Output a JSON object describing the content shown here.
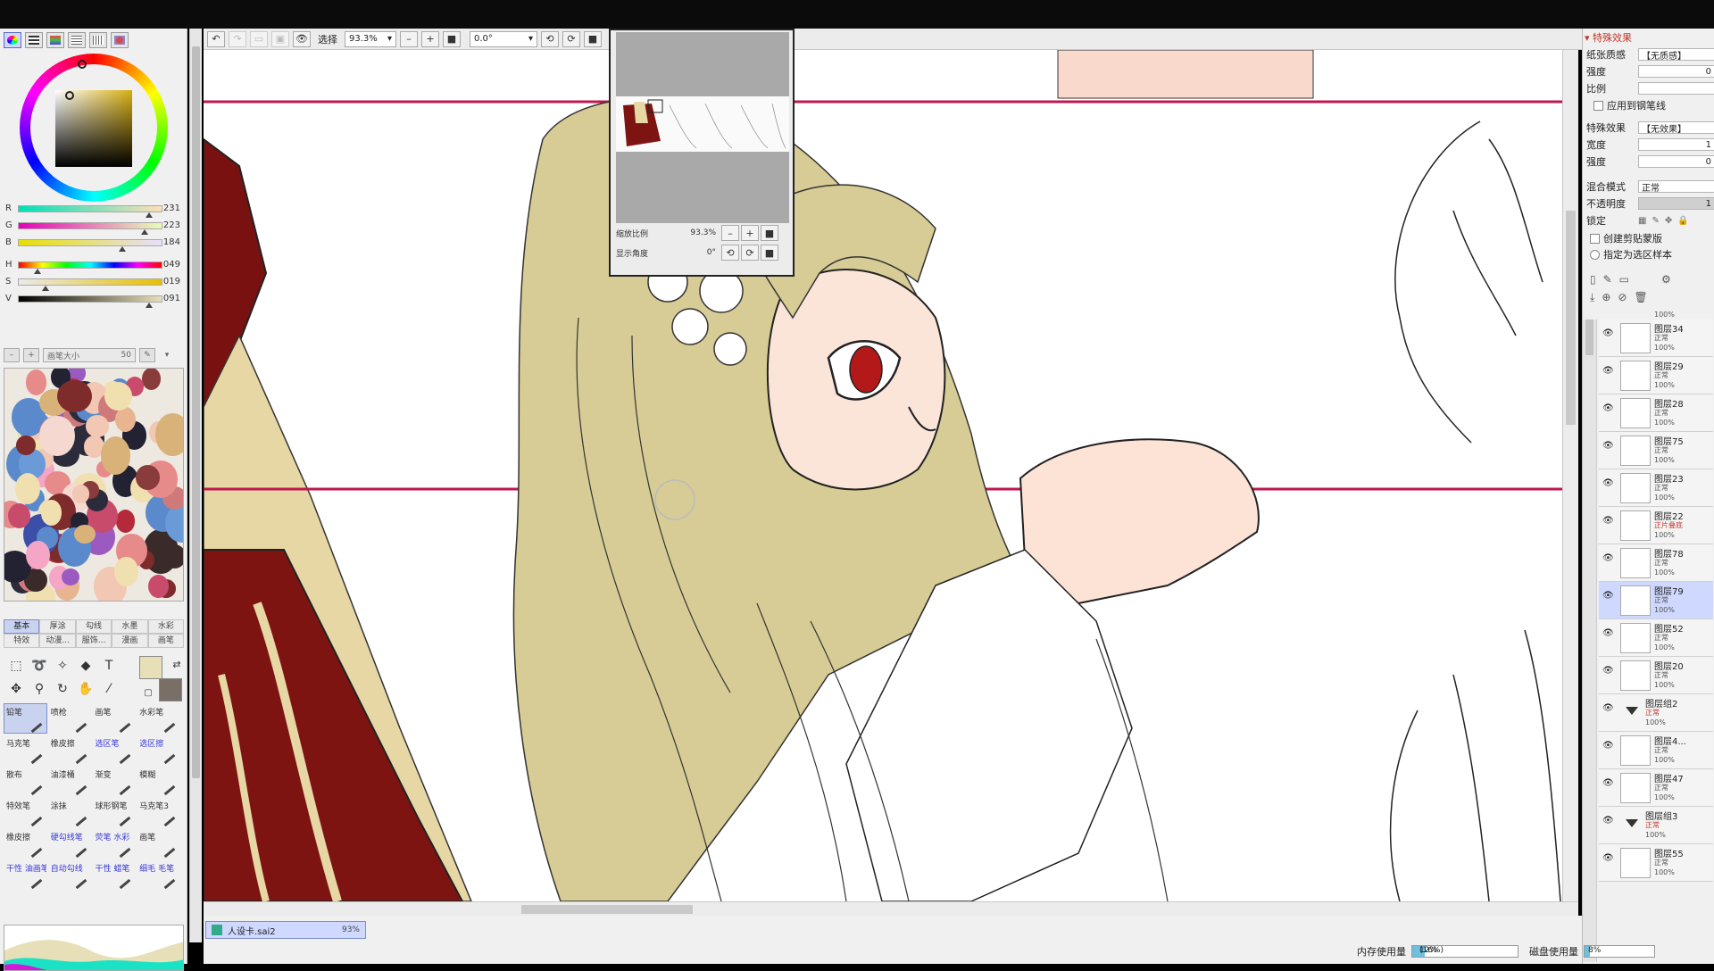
{
  "left_panel": {
    "sliders": [
      {
        "label": "R",
        "value": "231",
        "pos": 0.906
      },
      {
        "label": "G",
        "value": "223",
        "pos": 0.875
      },
      {
        "label": "B",
        "value": "184",
        "pos": 0.722
      },
      {
        "label": "H",
        "value": "049",
        "pos": 0.136
      },
      {
        "label": "S",
        "value": "019",
        "pos": 0.19
      },
      {
        "label": "V",
        "value": "091",
        "pos": 0.91
      }
    ],
    "brush_size_label": "画笔大小",
    "brush_size_value": "50",
    "category_tabs_row1": [
      "基本",
      "厚涂",
      "勾线",
      "水墨",
      "水彩"
    ],
    "category_tabs_row2": [
      "特效",
      "动漫...",
      "服饰...",
      "漫画",
      "画笔"
    ],
    "brushes": [
      {
        "label": "铅笔",
        "active": true,
        "blue": false
      },
      {
        "label": "喷枪",
        "active": false,
        "blue": false
      },
      {
        "label": "画笔",
        "active": false,
        "blue": false
      },
      {
        "label": "水彩笔",
        "active": false,
        "blue": false
      },
      {
        "label": "马克笔",
        "active": false,
        "blue": false
      },
      {
        "label": "橡皮擦",
        "active": false,
        "blue": false
      },
      {
        "label": "选区笔",
        "active": false,
        "blue": true
      },
      {
        "label": "选区擦",
        "active": false,
        "blue": true
      },
      {
        "label": "散布",
        "active": false,
        "blue": false
      },
      {
        "label": "油漆桶",
        "active": false,
        "blue": false
      },
      {
        "label": "渐变",
        "active": false,
        "blue": false
      },
      {
        "label": "模糊",
        "active": false,
        "blue": false
      },
      {
        "label": "特效笔",
        "active": false,
        "blue": false
      },
      {
        "label": "涂抹",
        "active": false,
        "blue": false
      },
      {
        "label": "球形钢笔",
        "active": false,
        "blue": false
      },
      {
        "label": "马克笔3",
        "active": false,
        "blue": false
      },
      {
        "label": "橡皮擦",
        "active": false,
        "blue": false
      },
      {
        "label": "硬勾线笔",
        "active": false,
        "blue": true
      },
      {
        "label": "荧笔 水彩",
        "active": false,
        "blue": true
      },
      {
        "label": "画笔",
        "active": false,
        "blue": false
      },
      {
        "label": "干性 油画笔",
        "active": false,
        "blue": true
      },
      {
        "label": "自动勾线",
        "active": false,
        "blue": true
      },
      {
        "label": "干性 蜡笔",
        "active": false,
        "blue": true
      },
      {
        "label": "细毛 毛笔",
        "active": false,
        "blue": true
      }
    ],
    "primary_color": "#e7dfb8",
    "secondary_color": "#7a6f66"
  },
  "toolbar": {
    "select_label": "选择",
    "zoom_value": "93.3%",
    "angle_value": "0.0°"
  },
  "navigator": {
    "zoom_label": "缩放比例",
    "zoom_value": "93.3%",
    "angle_label": "显示角度",
    "angle_value": "0°"
  },
  "right_panel": {
    "section_title": "特殊效果",
    "texture_label": "纸张质感",
    "texture_value": "【无质感】",
    "strength_label": "强度",
    "strength_value": "0",
    "ratio_label": "比例",
    "apply_lines_label": "应用到钢笔线",
    "effect_label": "特殊效果",
    "effect_value": "【无效果】",
    "width_label": "宽度",
    "width_value": "1",
    "strength2_label": "强度",
    "strength2_value": "0",
    "blend_label": "混合模式",
    "blend_value": "正常",
    "opacity_label": "不透明度",
    "opacity_value": "1",
    "lock_label": "锁定",
    "clip_label": "创建剪贴蒙版",
    "sample_label": "指定为选区样本",
    "top_partial_op": "100%"
  },
  "layers": [
    {
      "name": "图层34",
      "mode": "正常",
      "opacity": "100%",
      "selected": false,
      "group": false,
      "red": false
    },
    {
      "name": "图层29",
      "mode": "正常",
      "opacity": "100%",
      "selected": false,
      "group": false,
      "red": false
    },
    {
      "name": "图层28",
      "mode": "正常",
      "opacity": "100%",
      "selected": false,
      "group": false,
      "red": false
    },
    {
      "name": "图层75",
      "mode": "正常",
      "opacity": "100%",
      "selected": false,
      "group": false,
      "red": false
    },
    {
      "name": "图层23",
      "mode": "正常",
      "opacity": "100%",
      "selected": false,
      "group": false,
      "red": false
    },
    {
      "name": "图层22",
      "mode": "正片叠底",
      "opacity": "100%",
      "selected": false,
      "group": false,
      "red": true
    },
    {
      "name": "图层78",
      "mode": "正常",
      "opacity": "100%",
      "selected": false,
      "group": false,
      "red": false
    },
    {
      "name": "图层79",
      "mode": "正常",
      "opacity": "100%",
      "selected": true,
      "group": false,
      "red": false
    },
    {
      "name": "图层52",
      "mode": "正常",
      "opacity": "100%",
      "selected": false,
      "group": false,
      "red": false
    },
    {
      "name": "图层20",
      "mode": "正常",
      "opacity": "100%",
      "selected": false,
      "group": false,
      "red": false
    },
    {
      "name": "图层组2",
      "mode": "正常",
      "opacity": "100%",
      "selected": false,
      "group": true,
      "red": true
    },
    {
      "name": "图层4...",
      "mode": "正常",
      "opacity": "100%",
      "selected": false,
      "group": false,
      "red": false
    },
    {
      "name": "图层47",
      "mode": "正常",
      "opacity": "100%",
      "selected": false,
      "group": false,
      "red": false
    },
    {
      "name": "图层组3",
      "mode": "正常",
      "opacity": "100%",
      "selected": false,
      "group": true,
      "red": true
    },
    {
      "name": "图层55",
      "mode": "正常",
      "opacity": "100%",
      "selected": false,
      "group": false,
      "red": false
    }
  ],
  "document_tab": {
    "name": "人设卡.sai2",
    "zoom": "93%"
  },
  "status": {
    "memory_label": "内存使用量",
    "memory_value": "12%",
    "memory_detail": "(16%)",
    "memory_fraction": 0.12,
    "disk_label": "磁盘使用量",
    "disk_value": "8%",
    "disk_fraction": 0.08
  }
}
